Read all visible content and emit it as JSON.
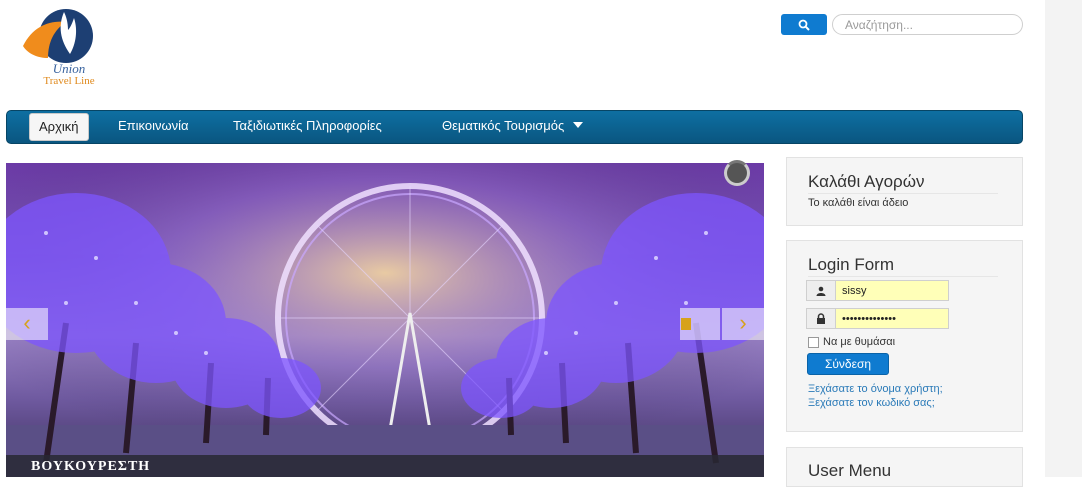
{
  "logo": {
    "line1": "Union",
    "line2": "Travel Line"
  },
  "search": {
    "button_icon": "search-icon",
    "placeholder": "Αναζήτηση..."
  },
  "nav": {
    "items": [
      {
        "label": "Αρχική",
        "active": true
      },
      {
        "label": "Επικοινωνία"
      },
      {
        "label": "Ταξιδιωτικές Πληροφορίες"
      },
      {
        "label": "Θεματικός Τουρισμός",
        "has_dropdown": true
      }
    ]
  },
  "slider": {
    "caption": "ΒΟΥΚΟΥΡΕΣΤΗ",
    "prev_icon": "‹",
    "next_icon": "›",
    "pause_icon": "pause-icon"
  },
  "cart": {
    "title": "Καλάθι Αγορών",
    "empty_text": "Το καλάθι είναι άδειο"
  },
  "login": {
    "title": "Login Form",
    "username": "sissy",
    "password": "••••••••••••••",
    "remember_label": "Να με θυμάσαι",
    "submit_label": "Σύνδεση",
    "forgot_username": "Ξεχάσατε το όνομα χρήστη;",
    "forgot_password": "Ξεχάσατε τον κωδικό σας;"
  },
  "user_menu": {
    "title": "User Menu"
  },
  "colors": {
    "accent": "#0f7bd0",
    "nav_bg": "#0a5680",
    "field_bg": "#ffffb8"
  }
}
